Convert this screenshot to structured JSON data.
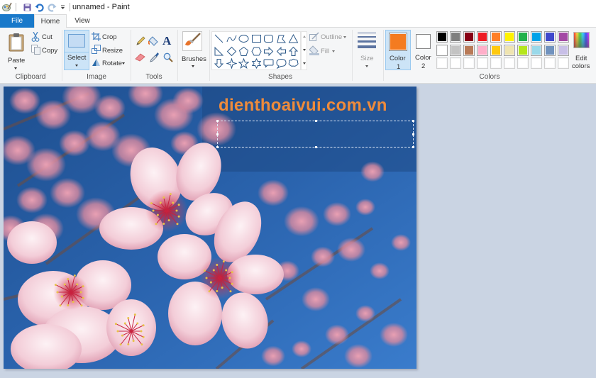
{
  "window": {
    "title": "unnamed - Paint"
  },
  "quick_access": {
    "items": [
      "paint-app",
      "save",
      "undo",
      "redo",
      "customize"
    ]
  },
  "tabs": [
    {
      "label": "File",
      "active": false
    },
    {
      "label": "Home",
      "active": true
    },
    {
      "label": "View",
      "active": false
    }
  ],
  "ribbon": {
    "clipboard": {
      "group_label": "Clipboard",
      "paste_label": "Paste",
      "cut_label": "Cut",
      "copy_label": "Copy"
    },
    "image": {
      "group_label": "Image",
      "select_label": "Select",
      "crop_label": "Crop",
      "resize_label": "Resize",
      "rotate_label": "Rotate"
    },
    "tools": {
      "group_label": "Tools",
      "items": [
        "pencil",
        "fill",
        "text",
        "eraser",
        "color-picker",
        "magnifier"
      ]
    },
    "brushes": {
      "label": "Brushes"
    },
    "shapes": {
      "group_label": "Shapes",
      "outline_label": "Outline",
      "fill_label": "Fill",
      "items": [
        "line",
        "curve",
        "oval",
        "rectangle",
        "rounded-rectangle",
        "polygon",
        "triangle",
        "right-triangle",
        "diamond",
        "pentagon",
        "hexagon",
        "right-arrow",
        "left-arrow",
        "up-arrow",
        "down-arrow",
        "four-point-star",
        "five-point-star",
        "six-point-star",
        "rounded-callout",
        "oval-callout",
        "cloud-callout"
      ]
    },
    "size": {
      "label": "Size"
    },
    "colors": {
      "group_label": "Colors",
      "color1_label": "Color",
      "color1_num": "1",
      "color1_value": "#f47b20",
      "color2_label": "Color",
      "color2_num": "2",
      "color2_value": "#ffffff",
      "edit_label_1": "Edit",
      "edit_label_2": "colors",
      "palette_row1": [
        "#000000",
        "#7f7f7f",
        "#880015",
        "#ed1c24",
        "#ff7f27",
        "#fff200",
        "#22b14c",
        "#00a2e8",
        "#3f48cc",
        "#a349a4"
      ],
      "palette_row2": [
        "#ffffff",
        "#c3c3c3",
        "#b97a57",
        "#ffaec9",
        "#ffc90e",
        "#efe4b0",
        "#b5e61d",
        "#99d9ea",
        "#7092be",
        "#c8bfe7"
      ],
      "palette_row3": [
        "",
        "",
        "",
        "",
        "",
        "",
        "",
        "",
        "",
        ""
      ]
    }
  },
  "canvas": {
    "watermark_text": "dienthoaivui.com.vn",
    "watermark_color": "#ee8b3b",
    "image_subject": "pink cherry blossoms against blue sky"
  }
}
